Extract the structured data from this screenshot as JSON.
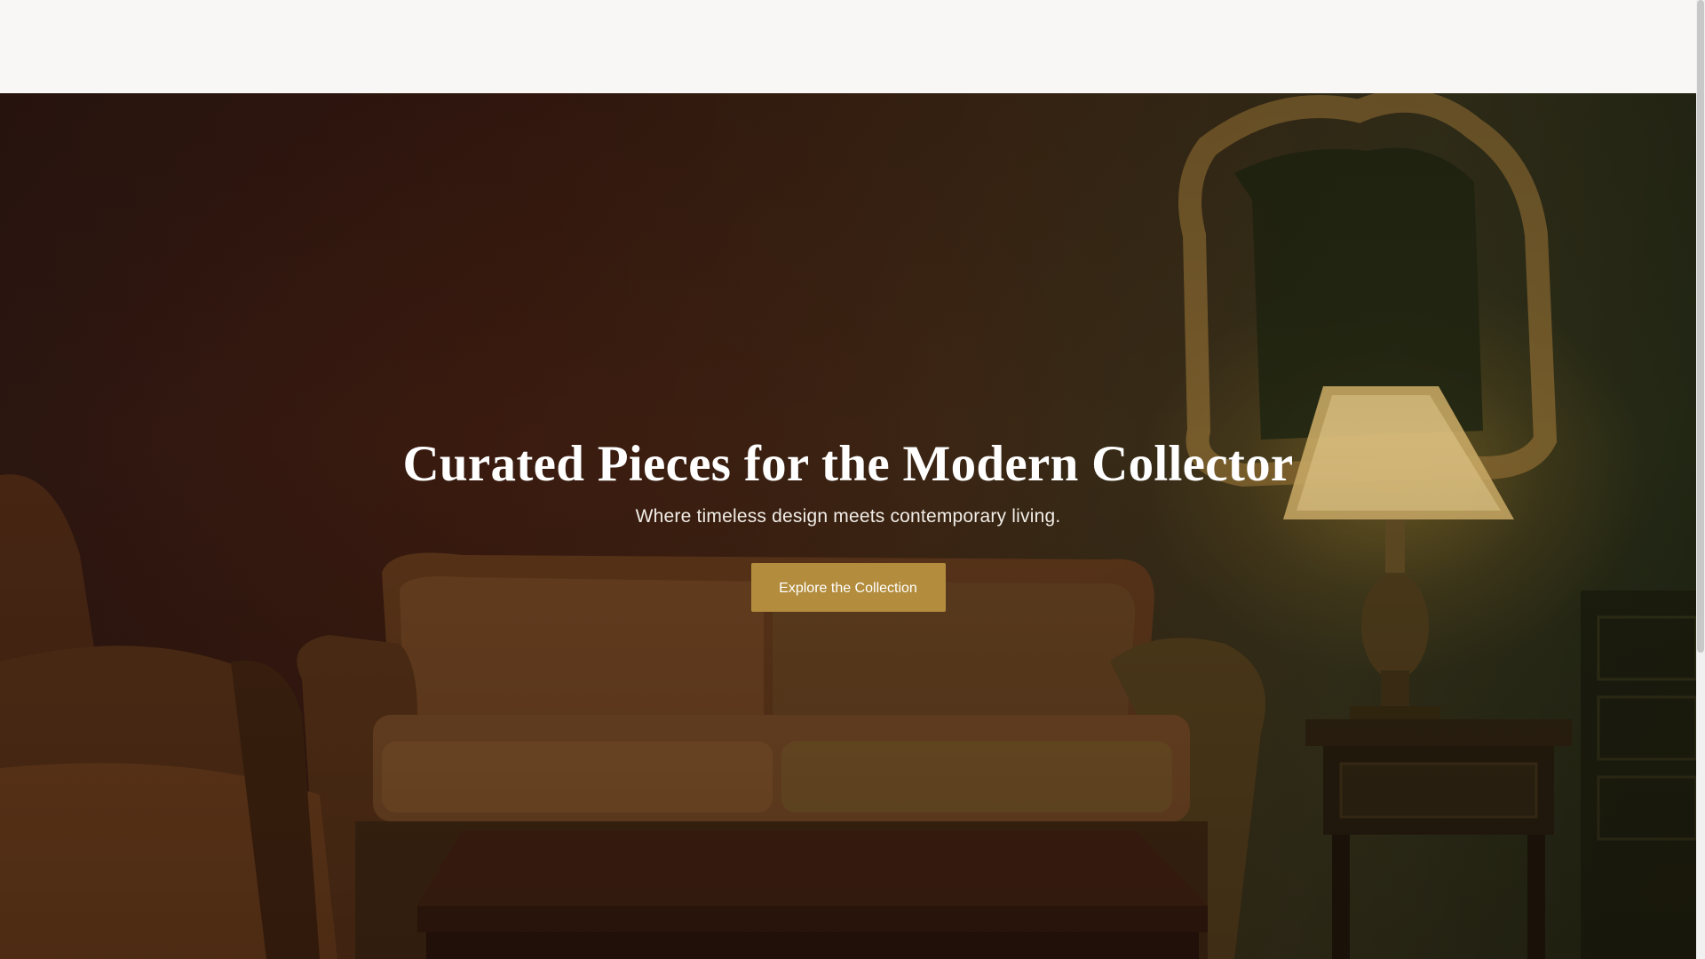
{
  "hero": {
    "title": "Curated Pieces for the Modern Collector",
    "subtitle": "Where timeless design meets contemporary living.",
    "cta_label": "Explore the Collection"
  },
  "colors": {
    "accent": "#b38d3d",
    "header_background": "#f8f7f5",
    "hero_text": "#ffffff"
  },
  "icons": {
    "background": "living-room-furniture-photo"
  }
}
